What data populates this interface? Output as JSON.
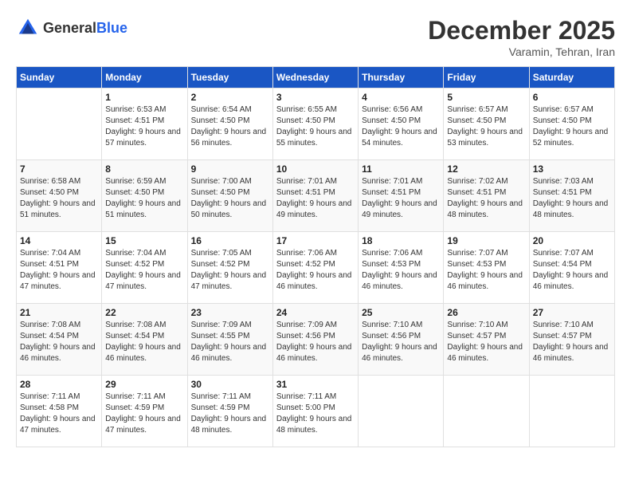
{
  "header": {
    "logo_general": "General",
    "logo_blue": "Blue",
    "month_title": "December 2025",
    "location": "Varamin, Tehran, Iran"
  },
  "weekdays": [
    "Sunday",
    "Monday",
    "Tuesday",
    "Wednesday",
    "Thursday",
    "Friday",
    "Saturday"
  ],
  "weeks": [
    [
      {
        "day": "",
        "sunrise": "",
        "sunset": "",
        "daylight": ""
      },
      {
        "day": "1",
        "sunrise": "Sunrise: 6:53 AM",
        "sunset": "Sunset: 4:51 PM",
        "daylight": "Daylight: 9 hours and 57 minutes."
      },
      {
        "day": "2",
        "sunrise": "Sunrise: 6:54 AM",
        "sunset": "Sunset: 4:50 PM",
        "daylight": "Daylight: 9 hours and 56 minutes."
      },
      {
        "day": "3",
        "sunrise": "Sunrise: 6:55 AM",
        "sunset": "Sunset: 4:50 PM",
        "daylight": "Daylight: 9 hours and 55 minutes."
      },
      {
        "day": "4",
        "sunrise": "Sunrise: 6:56 AM",
        "sunset": "Sunset: 4:50 PM",
        "daylight": "Daylight: 9 hours and 54 minutes."
      },
      {
        "day": "5",
        "sunrise": "Sunrise: 6:57 AM",
        "sunset": "Sunset: 4:50 PM",
        "daylight": "Daylight: 9 hours and 53 minutes."
      },
      {
        "day": "6",
        "sunrise": "Sunrise: 6:57 AM",
        "sunset": "Sunset: 4:50 PM",
        "daylight": "Daylight: 9 hours and 52 minutes."
      }
    ],
    [
      {
        "day": "7",
        "sunrise": "Sunrise: 6:58 AM",
        "sunset": "Sunset: 4:50 PM",
        "daylight": "Daylight: 9 hours and 51 minutes."
      },
      {
        "day": "8",
        "sunrise": "Sunrise: 6:59 AM",
        "sunset": "Sunset: 4:50 PM",
        "daylight": "Daylight: 9 hours and 51 minutes."
      },
      {
        "day": "9",
        "sunrise": "Sunrise: 7:00 AM",
        "sunset": "Sunset: 4:50 PM",
        "daylight": "Daylight: 9 hours and 50 minutes."
      },
      {
        "day": "10",
        "sunrise": "Sunrise: 7:01 AM",
        "sunset": "Sunset: 4:51 PM",
        "daylight": "Daylight: 9 hours and 49 minutes."
      },
      {
        "day": "11",
        "sunrise": "Sunrise: 7:01 AM",
        "sunset": "Sunset: 4:51 PM",
        "daylight": "Daylight: 9 hours and 49 minutes."
      },
      {
        "day": "12",
        "sunrise": "Sunrise: 7:02 AM",
        "sunset": "Sunset: 4:51 PM",
        "daylight": "Daylight: 9 hours and 48 minutes."
      },
      {
        "day": "13",
        "sunrise": "Sunrise: 7:03 AM",
        "sunset": "Sunset: 4:51 PM",
        "daylight": "Daylight: 9 hours and 48 minutes."
      }
    ],
    [
      {
        "day": "14",
        "sunrise": "Sunrise: 7:04 AM",
        "sunset": "Sunset: 4:51 PM",
        "daylight": "Daylight: 9 hours and 47 minutes."
      },
      {
        "day": "15",
        "sunrise": "Sunrise: 7:04 AM",
        "sunset": "Sunset: 4:52 PM",
        "daylight": "Daylight: 9 hours and 47 minutes."
      },
      {
        "day": "16",
        "sunrise": "Sunrise: 7:05 AM",
        "sunset": "Sunset: 4:52 PM",
        "daylight": "Daylight: 9 hours and 47 minutes."
      },
      {
        "day": "17",
        "sunrise": "Sunrise: 7:06 AM",
        "sunset": "Sunset: 4:52 PM",
        "daylight": "Daylight: 9 hours and 46 minutes."
      },
      {
        "day": "18",
        "sunrise": "Sunrise: 7:06 AM",
        "sunset": "Sunset: 4:53 PM",
        "daylight": "Daylight: 9 hours and 46 minutes."
      },
      {
        "day": "19",
        "sunrise": "Sunrise: 7:07 AM",
        "sunset": "Sunset: 4:53 PM",
        "daylight": "Daylight: 9 hours and 46 minutes."
      },
      {
        "day": "20",
        "sunrise": "Sunrise: 7:07 AM",
        "sunset": "Sunset: 4:54 PM",
        "daylight": "Daylight: 9 hours and 46 minutes."
      }
    ],
    [
      {
        "day": "21",
        "sunrise": "Sunrise: 7:08 AM",
        "sunset": "Sunset: 4:54 PM",
        "daylight": "Daylight: 9 hours and 46 minutes."
      },
      {
        "day": "22",
        "sunrise": "Sunrise: 7:08 AM",
        "sunset": "Sunset: 4:54 PM",
        "daylight": "Daylight: 9 hours and 46 minutes."
      },
      {
        "day": "23",
        "sunrise": "Sunrise: 7:09 AM",
        "sunset": "Sunset: 4:55 PM",
        "daylight": "Daylight: 9 hours and 46 minutes."
      },
      {
        "day": "24",
        "sunrise": "Sunrise: 7:09 AM",
        "sunset": "Sunset: 4:56 PM",
        "daylight": "Daylight: 9 hours and 46 minutes."
      },
      {
        "day": "25",
        "sunrise": "Sunrise: 7:10 AM",
        "sunset": "Sunset: 4:56 PM",
        "daylight": "Daylight: 9 hours and 46 minutes."
      },
      {
        "day": "26",
        "sunrise": "Sunrise: 7:10 AM",
        "sunset": "Sunset: 4:57 PM",
        "daylight": "Daylight: 9 hours and 46 minutes."
      },
      {
        "day": "27",
        "sunrise": "Sunrise: 7:10 AM",
        "sunset": "Sunset: 4:57 PM",
        "daylight": "Daylight: 9 hours and 46 minutes."
      }
    ],
    [
      {
        "day": "28",
        "sunrise": "Sunrise: 7:11 AM",
        "sunset": "Sunset: 4:58 PM",
        "daylight": "Daylight: 9 hours and 47 minutes."
      },
      {
        "day": "29",
        "sunrise": "Sunrise: 7:11 AM",
        "sunset": "Sunset: 4:59 PM",
        "daylight": "Daylight: 9 hours and 47 minutes."
      },
      {
        "day": "30",
        "sunrise": "Sunrise: 7:11 AM",
        "sunset": "Sunset: 4:59 PM",
        "daylight": "Daylight: 9 hours and 48 minutes."
      },
      {
        "day": "31",
        "sunrise": "Sunrise: 7:11 AM",
        "sunset": "Sunset: 5:00 PM",
        "daylight": "Daylight: 9 hours and 48 minutes."
      },
      {
        "day": "",
        "sunrise": "",
        "sunset": "",
        "daylight": ""
      },
      {
        "day": "",
        "sunrise": "",
        "sunset": "",
        "daylight": ""
      },
      {
        "day": "",
        "sunrise": "",
        "sunset": "",
        "daylight": ""
      }
    ]
  ]
}
